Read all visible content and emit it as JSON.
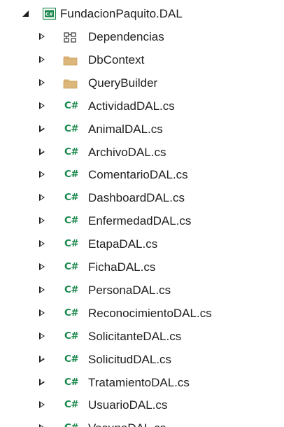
{
  "project": {
    "label": "FundacionPaquito.DAL",
    "icon": "csharp-project-icon",
    "expanded": true
  },
  "items": [
    {
      "label": "Dependencias",
      "icon": "dependencies-icon"
    },
    {
      "label": "DbContext",
      "icon": "folder-icon"
    },
    {
      "label": "QueryBuilder",
      "icon": "folder-icon"
    },
    {
      "label": "ActividadDAL.cs",
      "icon": "csharp-file-icon"
    },
    {
      "label": "AnimalDAL.cs",
      "icon": "csharp-file-icon"
    },
    {
      "label": "ArchivoDAL.cs",
      "icon": "csharp-file-icon"
    },
    {
      "label": "ComentarioDAL.cs",
      "icon": "csharp-file-icon"
    },
    {
      "label": "DashboardDAL.cs",
      "icon": "csharp-file-icon"
    },
    {
      "label": "EnfermedadDAL.cs",
      "icon": "csharp-file-icon"
    },
    {
      "label": "EtapaDAL.cs",
      "icon": "csharp-file-icon"
    },
    {
      "label": "FichaDAL.cs",
      "icon": "csharp-file-icon"
    },
    {
      "label": "PersonaDAL.cs",
      "icon": "csharp-file-icon"
    },
    {
      "label": "ReconocimientoDAL.cs",
      "icon": "csharp-file-icon"
    },
    {
      "label": "SolicitanteDAL.cs",
      "icon": "csharp-file-icon"
    },
    {
      "label": "SolicitudDAL.cs",
      "icon": "csharp-file-icon"
    },
    {
      "label": "TratamientoDAL.cs",
      "icon": "csharp-file-icon"
    },
    {
      "label": "UsuarioDAL.cs",
      "icon": "csharp-file-icon"
    },
    {
      "label": "VacunaDAL.cs",
      "icon": "csharp-file-icon"
    }
  ],
  "icon_text": {
    "csharp_file": "C#",
    "csharp_project": "C#"
  },
  "colors": {
    "text": "#1e1e1e",
    "csharp_green": "#17864a",
    "folder": "#dcb67a",
    "folder_dark": "#c9a25c",
    "project_border": "#17864a",
    "dependencies": "#424242"
  }
}
